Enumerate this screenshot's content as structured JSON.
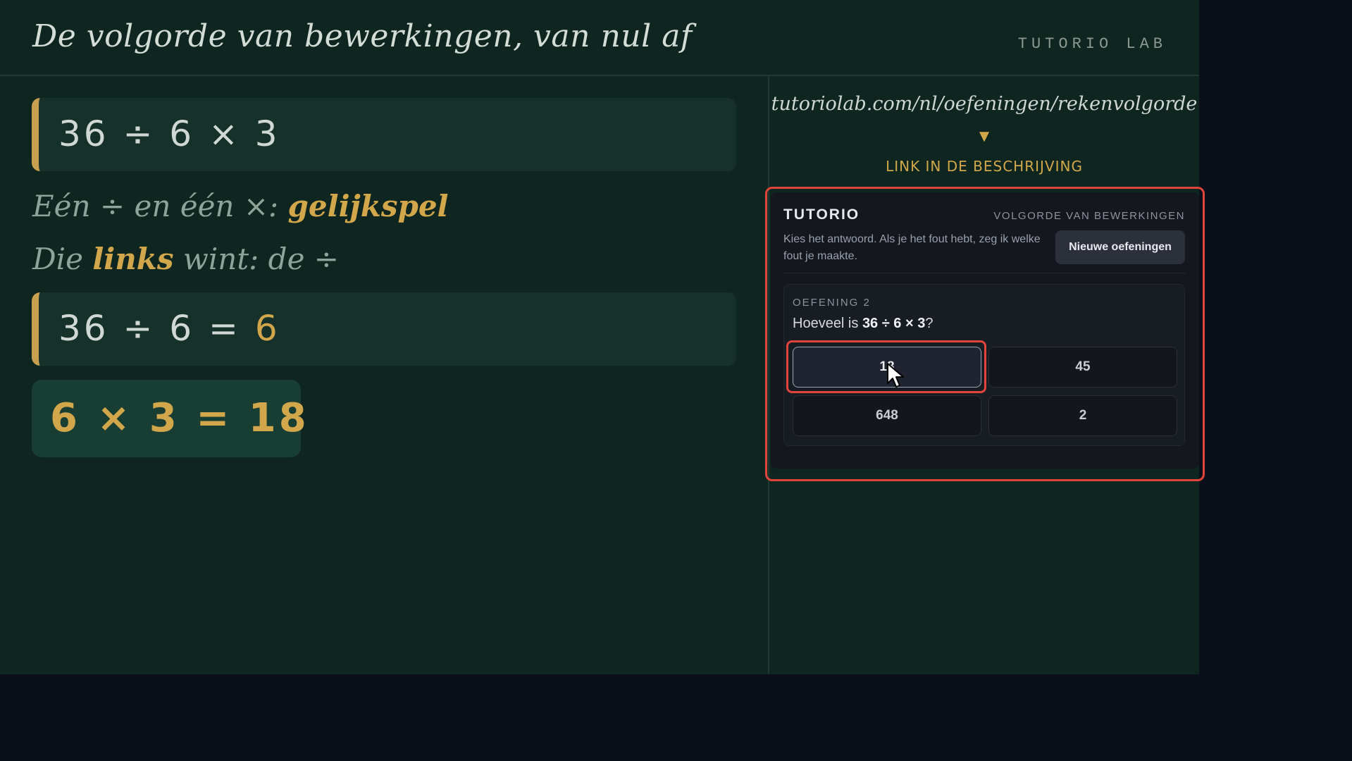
{
  "header": {
    "title": "De volgorde van bewerkingen, van nul af",
    "brand": "TUTORIO LAB"
  },
  "lesson": {
    "expression": "36 ÷ 6 × 3",
    "rule1_prefix": "Eén ÷ en één ×: ",
    "rule1_highlight": "gelijkspel",
    "rule2_prefix": "Die ",
    "rule2_highlight": "links",
    "rule2_suffix": " wint: de ÷",
    "step1_lhs": "36 ÷ 6 = ",
    "step1_result": "6",
    "step2": "6 × 3 = 18"
  },
  "sidebar": {
    "url": "tutoriolab.com/nl/oefeningen/rekenvolgorde",
    "arrow": "▼",
    "link_label": "LINK IN DE BESCHRIJVING"
  },
  "widget": {
    "brand": "TUTORIO",
    "topic": "VOLGORDE VAN BEWERKINGEN",
    "description": "Kies het antwoord. Als je het fout hebt, zeg ik welke fout je maakte.",
    "new_button": "Nieuwe oefeningen",
    "exercise_label": "OEFENING 2",
    "question_prefix": "Hoeveel is ",
    "question_expr": "36 ÷ 6 × 3",
    "question_suffix": "?",
    "options": [
      "18",
      "45",
      "648",
      "2"
    ],
    "selected_option": "18"
  },
  "colors": {
    "board": "#0f2620",
    "gold": "#d2a74b",
    "highlight": "#e0443a"
  }
}
